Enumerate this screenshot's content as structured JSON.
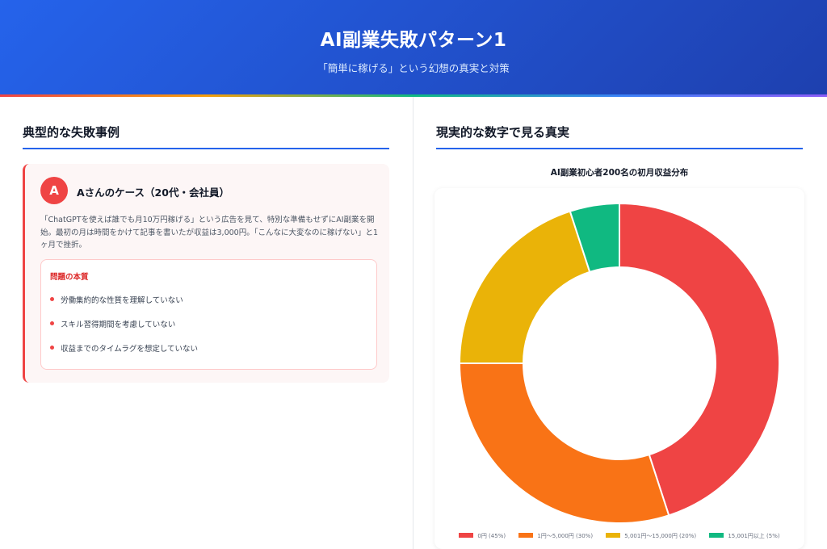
{
  "header": {
    "title": "AI副業失敗パターン1",
    "subtitle": "「簡単に稼げる」という幻想の真実と対策"
  },
  "left": {
    "section_title": "典型的な失敗事例",
    "case": {
      "avatar_letter": "A",
      "title": "Aさんのケース（20代・会社員）",
      "description": "「ChatGPTを使えば誰でも月10万円稼げる」という広告を見て、特別な準備もせずにAI副業を開始。最初の月は時間をかけて記事を書いたが収益は3,000円。「こんなに大変なのに稼げない」と1ヶ月で挫折。",
      "problem_title": "問題の本質",
      "problems": [
        "労働集約的な性質を理解していない",
        "スキル習得期間を考慮していない",
        "収益までのタイムラグを想定していない"
      ]
    }
  },
  "right": {
    "section_title": "現実的な数字で見る真実"
  },
  "chart_data": {
    "type": "pie",
    "subtype": "doughnut",
    "title": "AI副業初心者200名の初月収益分布",
    "categories": [
      "0円",
      "1円〜5,000円",
      "5,001円〜15,000円",
      "15,001円以上"
    ],
    "values": [
      45,
      30,
      20,
      5
    ],
    "legend_labels": [
      "0円 (45%)",
      "1円〜5,000円 (30%)",
      "5,001円〜15,000円 (20%)",
      "15,001円以上 (5%)"
    ],
    "colors": [
      "#ef4444",
      "#f97316",
      "#eab308",
      "#10b981"
    ],
    "legend_position": "bottom"
  }
}
